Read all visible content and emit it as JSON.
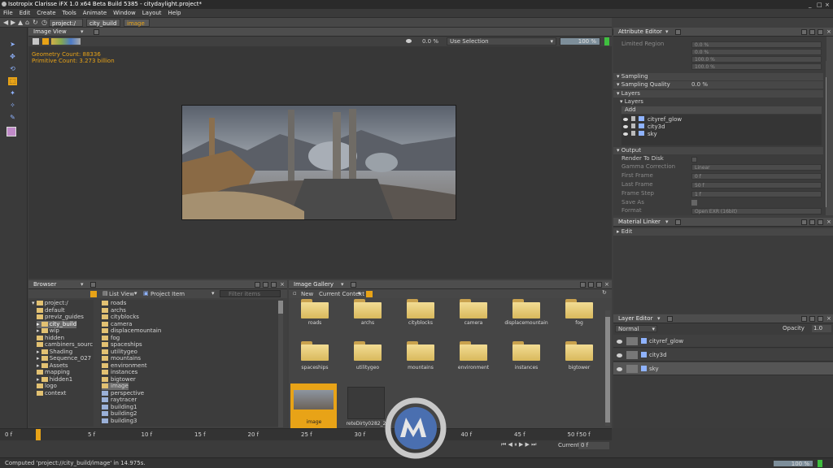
{
  "window": {
    "title": "Isotropix Clarisse iFX 1.0 x64 Beta Build 5385 - citydaylight.project*",
    "controls": [
      "_",
      "□",
      "×"
    ]
  },
  "menu": [
    "File",
    "Edit",
    "Create",
    "Tools",
    "Animate",
    "Window",
    "Layout",
    "Help"
  ],
  "breadcrumb": [
    "project:/",
    "city_build",
    "image"
  ],
  "image_view": {
    "title": "Image View",
    "zoom": "0.0 %",
    "selection": "Use Selection",
    "progress": "100 %",
    "geometry_count": "Geometry Count: 88336",
    "primitive_count": "Primitive Count: 3.273 billion"
  },
  "attribute_editor": {
    "title": "Attribute Editor",
    "limited_region_label": "Limited Region",
    "limited_region_values": [
      "0.0 %",
      "0.0 %",
      "100.0 %",
      "100.0 %"
    ],
    "sampling_section": "Sampling",
    "sampling_quality_label": "Sampling Quality",
    "sampling_quality_value": "0.0 %",
    "layers_section": "Layers",
    "layers_sub": "Layers",
    "add_button": "Add",
    "layers": [
      "cityref_glow",
      "city3d",
      "sky"
    ],
    "output_section": "Output",
    "render_to_disk": "Render To Disk",
    "gamma_correction_label": "Gamma Correction",
    "gamma_correction_value": "Linear",
    "first_frame_label": "First Frame",
    "first_frame_value": "0 f",
    "last_frame_label": "Last Frame",
    "last_frame_value": "50 f",
    "frame_step_label": "Frame Step",
    "frame_step_value": "1 f",
    "save_as_label": "Save As",
    "format_label": "Format",
    "format_value": "Open EXR (16bit)"
  },
  "material_linker": {
    "title": "Material Linker",
    "edit_label": "Edit"
  },
  "layer_editor": {
    "title": "Layer Editor",
    "blend_mode": "Normal",
    "opacity_label": "Opacity",
    "opacity_value": "1.0",
    "layers": [
      "cityref_glow",
      "city3d",
      "sky"
    ]
  },
  "browser": {
    "title": "Browser",
    "view_mode": "List View",
    "project_item": "Project Item",
    "filter_placeholder": "Filter items",
    "tree": [
      "project:/",
      "default",
      "previz_guides",
      "city_build",
      "wip",
      "hidden",
      "cambiners_sourc",
      "Shading",
      "Sequence_027",
      "Assets",
      "mapping",
      "hidden1",
      "logo",
      "context"
    ],
    "items": [
      "roads",
      "archs",
      "cityblocks",
      "camera",
      "displacemountain",
      "fog",
      "spaceships",
      "utilitygeo",
      "mountains",
      "environment",
      "instances",
      "bigtower",
      "image",
      "perspective",
      "raytracer",
      "building1",
      "building2",
      "building3"
    ]
  },
  "image_gallery": {
    "title": "Image Gallery",
    "new_button": "New",
    "context": "Current Context",
    "folders_row1": [
      "roads",
      "archs",
      "cityblocks",
      "camera",
      "displacemountain",
      "fog"
    ],
    "folders_row2": [
      "spaceships",
      "utilitygeo",
      "mountains",
      "environment",
      "instances",
      "bigtower"
    ],
    "images": [
      "image",
      "reteDirty0282_2"
    ]
  },
  "timeline": {
    "start": "0 f",
    "ticks": [
      "5 f",
      "10 f",
      "15 f",
      "20 f",
      "25 f",
      "30 f",
      "35 f",
      "40 f",
      "45 f",
      "50 f"
    ],
    "end": "50 f",
    "current_label": "Current",
    "current_value": "0 f"
  },
  "status": {
    "message": "Computed 'project://city_build/image' in 14.975s.",
    "memory": "100 %"
  },
  "colors": {
    "accent_orange": "#e8a317",
    "folder_yellow": "#e6c66e",
    "progress_green": "#3fbf3f"
  }
}
